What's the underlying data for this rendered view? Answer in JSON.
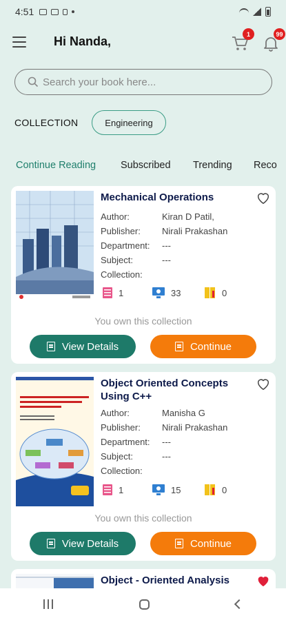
{
  "status": {
    "time": "4:51"
  },
  "header": {
    "greeting": "Hi Nanda,",
    "cart_count": "1",
    "notif_count": "99"
  },
  "search": {
    "placeholder": "Search your book here..."
  },
  "collection": {
    "label": "COLLECTION",
    "chip": "Engineering"
  },
  "tabs": [
    "Continue Reading",
    "Subscribed",
    "Trending",
    "Reco"
  ],
  "labels": {
    "author": "Author:",
    "publisher": "Publisher:",
    "department": "Department:",
    "subject": "Subject:",
    "collection": "Collection:",
    "owned": "You own this collection",
    "view": "View Details",
    "continue": "Continue"
  },
  "books": [
    {
      "title": "Mechanical Operations",
      "author": "Kiran D Patil,",
      "publisher": "Nirali Prakashan",
      "department": "---",
      "subject": "---",
      "collection": "",
      "count_books": "1",
      "count_digital": "33",
      "count_notes": "0",
      "favorite": false,
      "cover_title": "MECHANICAL OPERATIONS",
      "cover_sub": "FUNDAMENTAL PRINCIPLES AND APPLICATIONS",
      "cover_author": "Dr. KIRAN D. PATIL",
      "cover_pub": "NIRALI PRAKASHAN"
    },
    {
      "title": "Object Oriented Concepts Using C++",
      "author": "Manisha G",
      "publisher": "Nirali Prakashan",
      "department": "---",
      "subject": "---",
      "collection": "",
      "count_books": "1",
      "count_digital": "15",
      "count_notes": "0",
      "favorite": false,
      "cover_title": "OBJECT ORIENTED CONCEPTS USING C++"
    },
    {
      "title": "Object - Oriented Analysis",
      "favorite": true
    }
  ],
  "colors": {
    "primary": "#1e7a69",
    "accent": "#f47b0b",
    "favorite": "#e0203a"
  }
}
